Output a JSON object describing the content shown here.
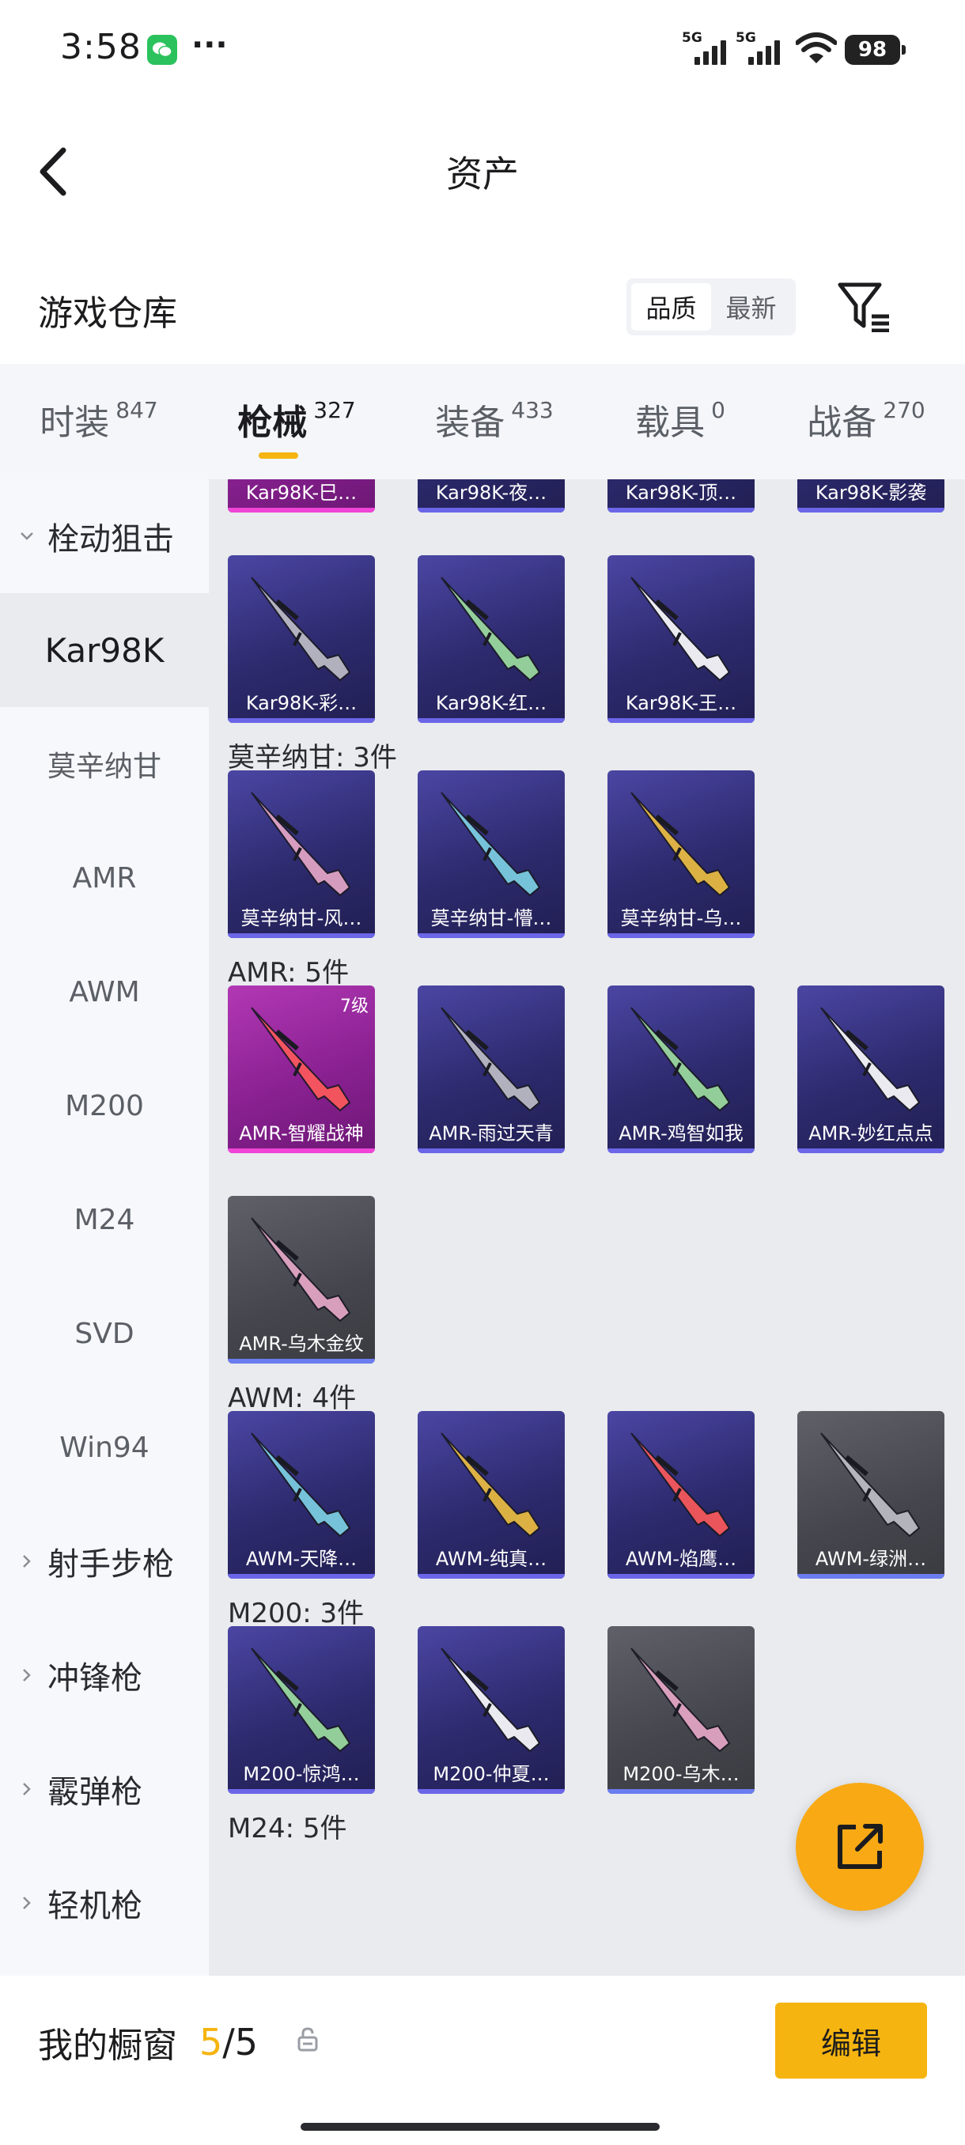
{
  "status": {
    "time": "3:58",
    "signal1": "5G",
    "signal2": "5G",
    "battery": "98"
  },
  "nav": {
    "title": "资产"
  },
  "header": {
    "title": "游戏仓库",
    "sort_options": [
      "品质",
      "最新"
    ]
  },
  "tabs": [
    {
      "label": "时装",
      "count": "847"
    },
    {
      "label": "枪械",
      "count": "327"
    },
    {
      "label": "装备",
      "count": "433"
    },
    {
      "label": "载具",
      "count": "0"
    },
    {
      "label": "战备",
      "count": "270"
    }
  ],
  "sidebar": [
    {
      "label": "栓动狙击",
      "type": "category"
    },
    {
      "label": "Kar98K",
      "type": "item"
    },
    {
      "label": "莫辛纳甘",
      "type": "item"
    },
    {
      "label": "AMR",
      "type": "item"
    },
    {
      "label": "AWM",
      "type": "item"
    },
    {
      "label": "M200",
      "type": "item"
    },
    {
      "label": "M24",
      "type": "item"
    },
    {
      "label": "SVD",
      "type": "item"
    },
    {
      "label": "Win94",
      "type": "item"
    },
    {
      "label": "射手步枪",
      "type": "category"
    },
    {
      "label": "冲锋枪",
      "type": "category"
    },
    {
      "label": "霰弹枪",
      "type": "category"
    },
    {
      "label": "轻机枪",
      "type": "category"
    }
  ],
  "sections": [
    {
      "title": "",
      "items": [
        {
          "label": "Kar98K-巳…",
          "tier": "pink"
        },
        {
          "label": "Kar98K-夜…",
          "tier": "purple"
        },
        {
          "label": "Kar98K-顶…",
          "tier": "purple"
        },
        {
          "label": "Kar98K-影袭",
          "tier": "purple"
        },
        {
          "label": "Kar98K-彩…",
          "tier": "purple"
        },
        {
          "label": "Kar98K-红…",
          "tier": "purple"
        },
        {
          "label": "Kar98K-王…",
          "tier": "purple"
        }
      ]
    },
    {
      "title": "莫辛纳甘: 3件",
      "items": [
        {
          "label": "莫辛纳甘-风…",
          "tier": "purple"
        },
        {
          "label": "莫辛纳甘-懵…",
          "tier": "purple"
        },
        {
          "label": "莫辛纳甘-乌…",
          "tier": "purple"
        }
      ]
    },
    {
      "title": "AMR: 5件",
      "items": [
        {
          "label": "AMR-智耀战神",
          "tier": "pink",
          "level": "7级"
        },
        {
          "label": "AMR-雨过天青",
          "tier": "purple"
        },
        {
          "label": "AMR-鸡智如我",
          "tier": "purple"
        },
        {
          "label": "AMR-妙红点点",
          "tier": "purple"
        },
        {
          "label": "AMR-乌木金纹",
          "tier": "gray"
        }
      ]
    },
    {
      "title": "AWM: 4件",
      "items": [
        {
          "label": "AWM-天降…",
          "tier": "purple"
        },
        {
          "label": "AWM-纯真…",
          "tier": "purple"
        },
        {
          "label": "AWM-焰鹰…",
          "tier": "purple"
        },
        {
          "label": "AWM-绿洲…",
          "tier": "gray"
        }
      ]
    },
    {
      "title": "M200: 3件",
      "items": [
        {
          "label": "M200-惊鸿…",
          "tier": "purple"
        },
        {
          "label": "M200-仲夏…",
          "tier": "purple"
        },
        {
          "label": "M200-乌木…",
          "tier": "gray"
        }
      ]
    },
    {
      "title": "M24: 5件",
      "items": []
    }
  ],
  "showcase": {
    "label": "我的橱窗",
    "count_current": "5",
    "count_sep": "/",
    "count_total": "5",
    "edit_label": "编辑"
  },
  "colors": {
    "accent": "#f5b40f",
    "fab": "#f8a914",
    "purple_card": "#2d2a6e",
    "pink_card": "#8a2192",
    "gray_card": "#45464d"
  }
}
